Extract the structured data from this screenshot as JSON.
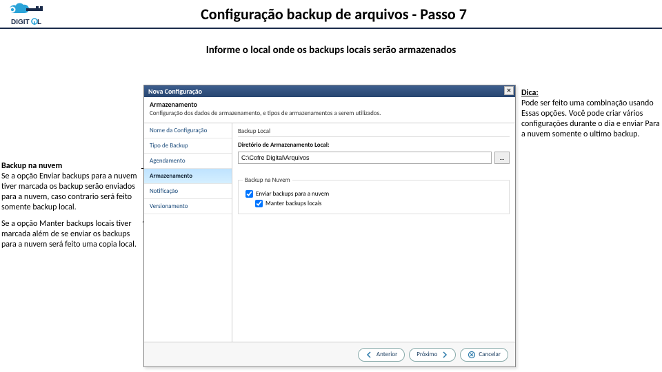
{
  "header": {
    "title": "Configuração backup de arquivos - Passo 7"
  },
  "subtitle": "Informe o local onde os backups locais serão armazenados",
  "dialog": {
    "title": "Nova Configuração",
    "section_title": "Armazenamento",
    "section_desc": "Configuração dos dados de armazenamento, e tipos de armazenamentos a serem utilizados.",
    "side": [
      "Nome da Configuração",
      "Tipo de Backup",
      "Agendamento",
      "Armazenamento",
      "Notificação",
      "Versionamento"
    ],
    "local_group": "Backup Local",
    "local_label": "Diretório de Armazenamento Local:",
    "local_path": "C:\\Cofre Digital\\Arquivos",
    "browse": "...",
    "cloud_group": "Backup na Nuvem",
    "chk_send": "Enviar backups para a nuvem",
    "chk_keep": "Manter backups locais",
    "btn_back": "Anterior",
    "btn_next": "Próximo",
    "btn_cancel": "Cancelar"
  },
  "notes": {
    "left1_h": "Backup na nuvem",
    "left1_b": "Se a opção Enviar backups para a nuvem tiver marcada os backup serão enviados para a nuvem, caso contrario será feito somente backup local.",
    "left2_b": "Se a opção Manter backups locais tiver marcada além de se enviar os backups para a nuvem será feito uma copia local.",
    "right_h": "Dica:",
    "right_b": "Pode ser feito uma combinação usando Essas opções. Você pode criar vários configurações durante o dia e enviar Para a nuvem somente o ultimo backup."
  }
}
